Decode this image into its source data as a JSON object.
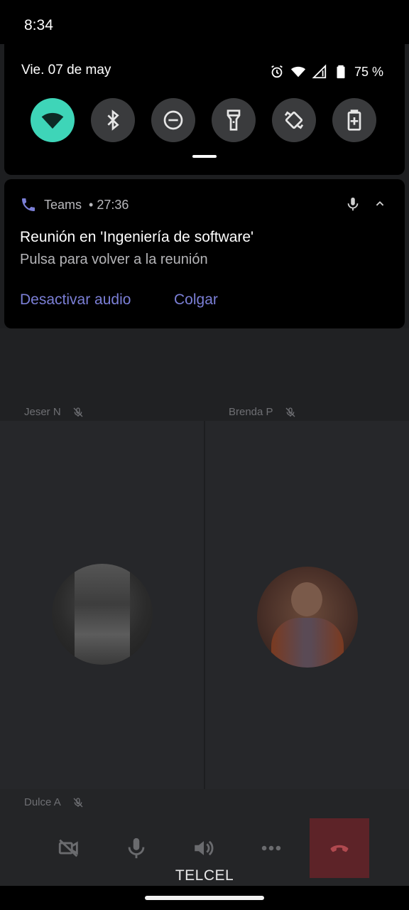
{
  "status_bar": {
    "time": "8:34"
  },
  "quick_settings": {
    "date": "Vie. 07 de may",
    "battery_text": "75 %",
    "accent_color": "#3ed5b8",
    "tiles": [
      {
        "name": "wifi",
        "active": true
      },
      {
        "name": "bluetooth",
        "active": false
      },
      {
        "name": "do-not-disturb",
        "active": false
      },
      {
        "name": "flashlight",
        "active": false
      },
      {
        "name": "auto-rotate",
        "active": false
      },
      {
        "name": "battery-saver",
        "active": false
      }
    ]
  },
  "notification": {
    "app_name": "Teams",
    "elapsed": "• 27:36",
    "title": "Reunión en 'Ingeniería de software'",
    "subtitle": "Pulsa para volver a la reunión",
    "actions": {
      "mute": "Desactivar audio",
      "hang_up": "Colgar"
    },
    "action_color": "#7b7fd6"
  },
  "call": {
    "participants": [
      {
        "name": "Jeser N",
        "muted": true
      },
      {
        "name": "Brenda P",
        "muted": true
      },
      {
        "name": "Dulce A",
        "muted": true
      }
    ],
    "controls": [
      "camera-off",
      "microphone",
      "speaker",
      "more",
      "hang-up"
    ],
    "hangup_color": "#5d2328"
  },
  "carrier": "TELCEL"
}
